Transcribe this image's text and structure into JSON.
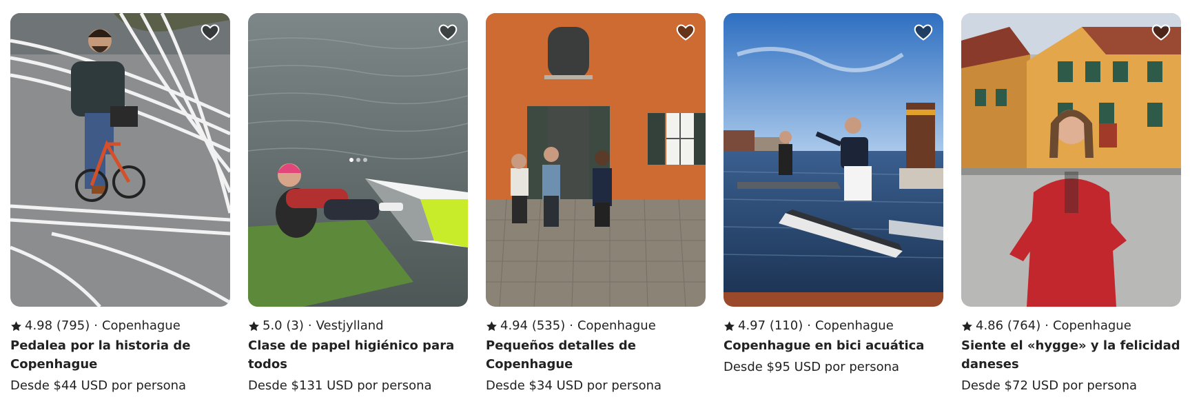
{
  "cards": [
    {
      "rating": "4.98",
      "reviews": "(795)",
      "location": "Copenhague",
      "separator": "·",
      "title": "Pedalea por la historia de Copenhague",
      "price": "Desde $44 USD por persona"
    },
    {
      "rating": "5.0",
      "reviews": "(3)",
      "location": "Vestjylland",
      "separator": "·",
      "title": "Clase de papel higiénico para todos",
      "price": "Desde $131 USD por persona"
    },
    {
      "rating": "4.94",
      "reviews": "(535)",
      "location": "Copenhague",
      "separator": "·",
      "title": "Pequeños detalles de Copenhague",
      "price": "Desde $34 USD por persona"
    },
    {
      "rating": "4.97",
      "reviews": "(110)",
      "location": "Copenhague",
      "separator": "·",
      "title": "Copenhague en bici acuática",
      "price": "Desde $95 USD por persona"
    },
    {
      "rating": "4.86",
      "reviews": "(764)",
      "location": "Copenhague",
      "separator": "·",
      "title": "Siente el «hygge» y la felicidad daneses",
      "price": "Desde $72 USD por persona"
    }
  ],
  "icons": {
    "favorite": "heart-icon",
    "rating": "star-icon"
  },
  "colors": {
    "text": "#222222",
    "heart_fill": "rgba(0,0,0,0.5)",
    "heart_stroke": "#ffffff"
  }
}
